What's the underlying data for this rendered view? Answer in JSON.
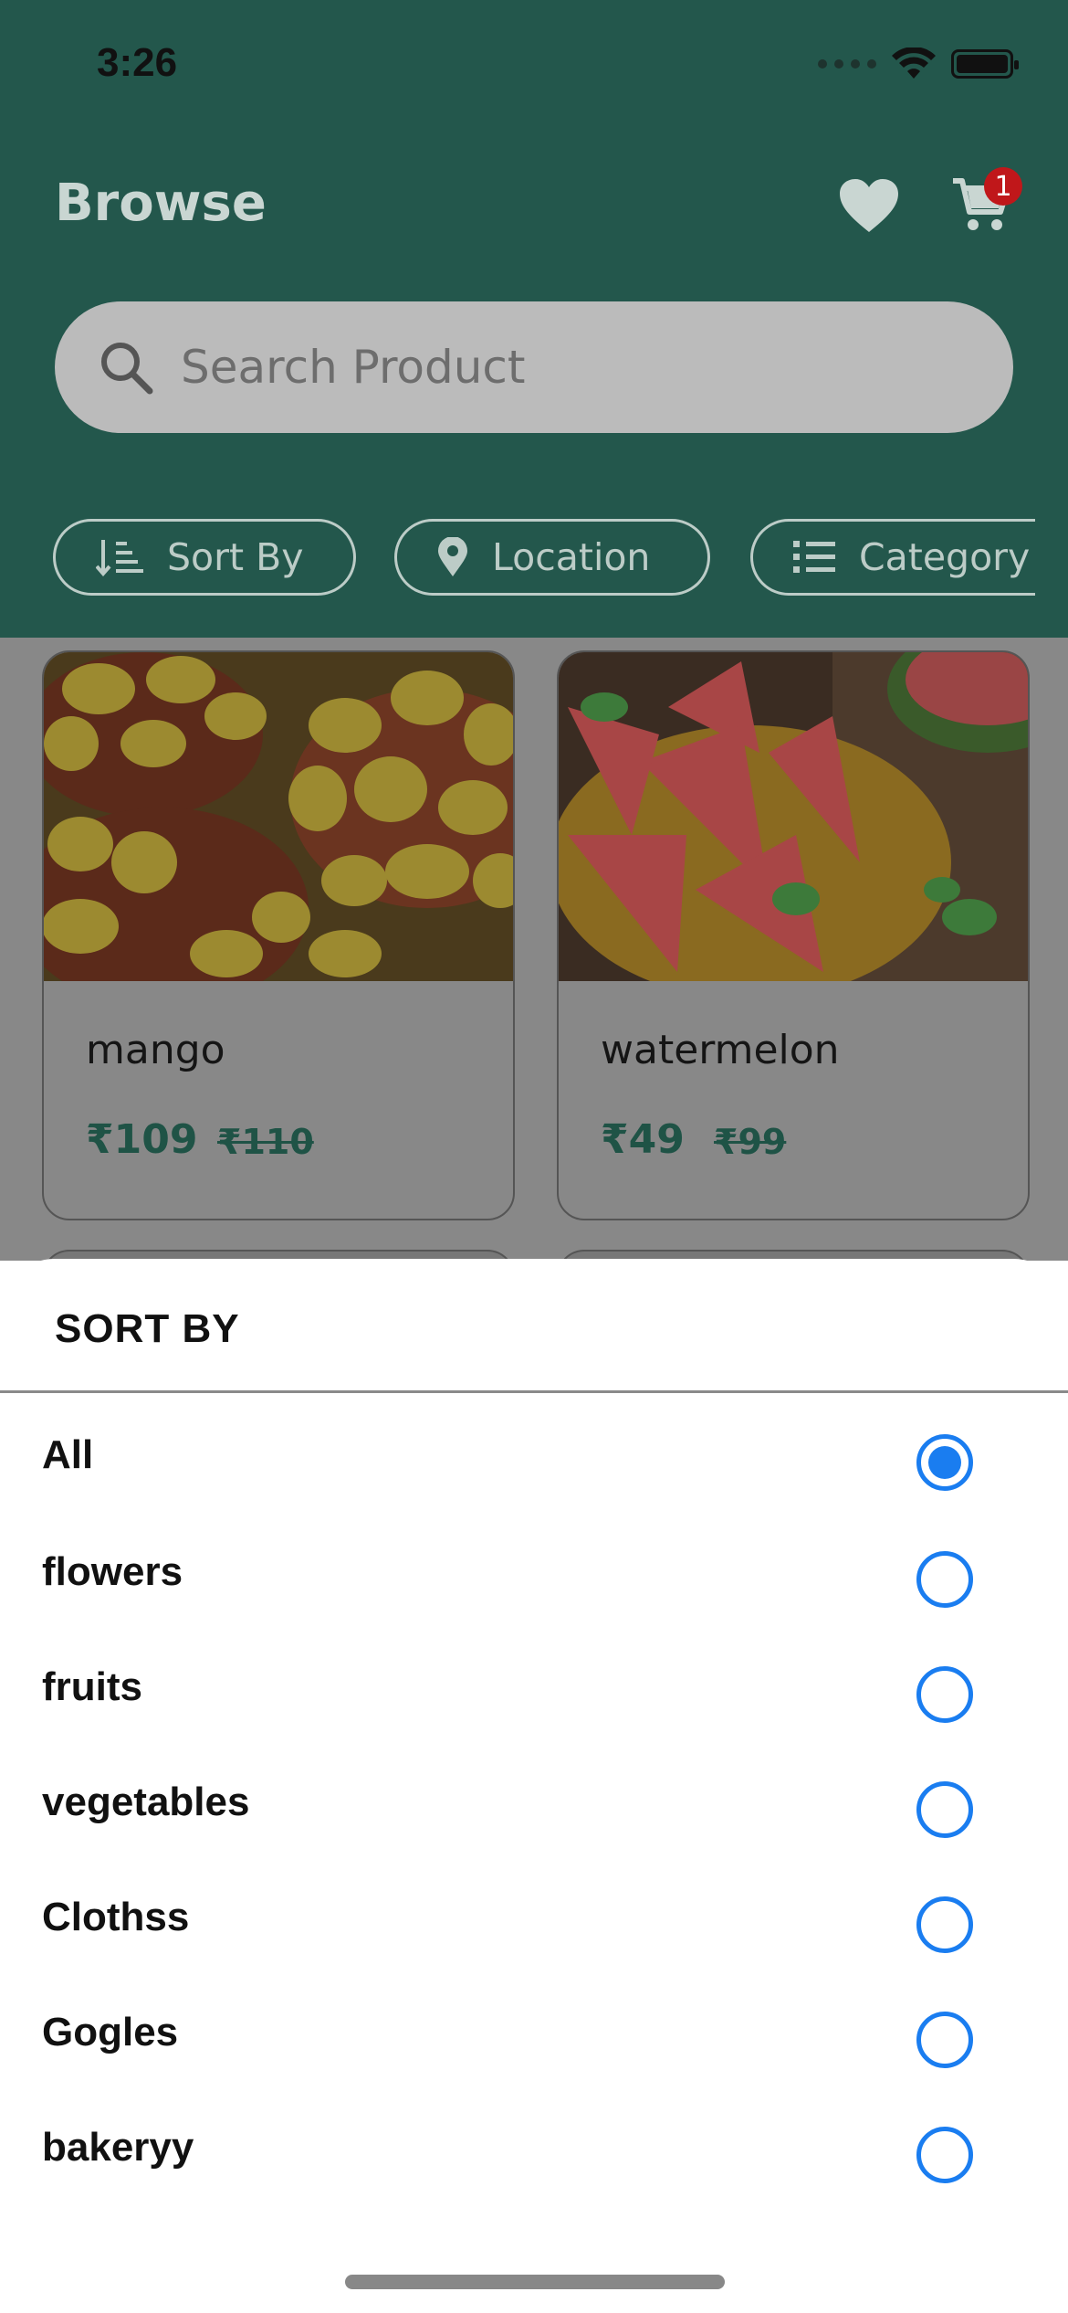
{
  "status_bar": {
    "time": "3:26"
  },
  "header": {
    "title": "Browse",
    "cart_count": "1"
  },
  "search": {
    "placeholder": "Search Product"
  },
  "filters": {
    "sort_label": "Sort By",
    "location_label": "Location",
    "category_label": "Category"
  },
  "products": [
    {
      "name": "mango",
      "price": "₹109",
      "mrp": "₹110"
    },
    {
      "name": "watermelon",
      "price": "₹49",
      "mrp": "₹99"
    }
  ],
  "sort_sheet": {
    "title": "SORT BY",
    "selected": "All",
    "options": [
      "All",
      "flowers",
      "fruits",
      "vegetables",
      "Clothss",
      "Gogles",
      "bakeryy"
    ]
  },
  "colors": {
    "header_bg": "#23574C",
    "accent_blue": "#1a7df0",
    "price_green": "#1f5346",
    "badge_red": "#c0171a"
  },
  "icons": [
    "search-icon",
    "heart-icon",
    "cart-icon",
    "sort-icon",
    "location-pin-icon",
    "list-icon",
    "wifi-icon",
    "battery-icon"
  ]
}
